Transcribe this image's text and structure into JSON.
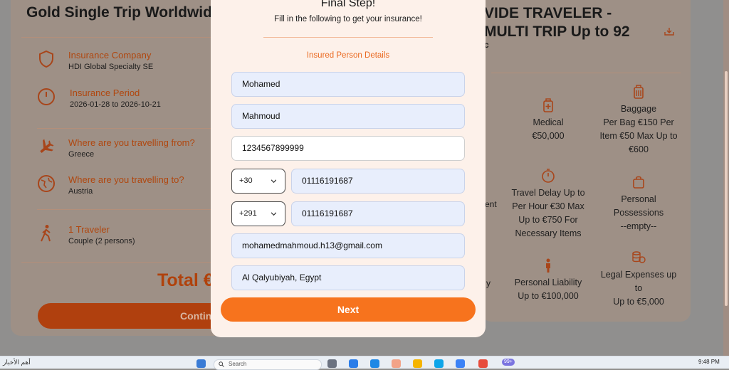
{
  "background": {
    "left_plan_title": "Gold Single Trip Worldwide",
    "right_plan_title_line1": "VIDE TRAVELER -",
    "right_plan_title_line2": "MULTI TRIP Up to 92",
    "right_plan_title_line3": "c",
    "insurance_company_label": "Insurance Company",
    "insurance_company_value": "HDI Global Specialty SE",
    "insurance_period_label": "Insurance Period",
    "insurance_period_value": "2026-01-28 to 2026-10-21",
    "from_label": "Where are you travelling from?",
    "from_value": "Greece",
    "to_label": "Where are you travelling to?",
    "to_value": "Austria",
    "traveler_label": "1 Traveler",
    "traveler_value": "Couple (2 persons)",
    "total_label": "Total €",
    "continue_label": "Contin",
    "side_text_1": "ent",
    "side_text_2": "y",
    "benefits": [
      {
        "label": "Medical\n€50,000"
      },
      {
        "label": "Baggage\nPer Bag €150 Per\nItem €50 Max Up to\n€600"
      },
      {
        "label": "Travel Delay Up to\nPer Hour €30 Max\nUp to €750 For\nNecessary Items"
      },
      {
        "label": "Personal\nPossessions\n--empty--"
      },
      {
        "label": "Personal Liability\nUp to €100,000"
      },
      {
        "label": "Legal Expenses up\nto\nUp to €5,000"
      }
    ]
  },
  "modal": {
    "title": "Final Step!",
    "subtitle": "Fill in the following to get your insurance!",
    "section_title": "Insured Person Details",
    "first_name": "Mohamed",
    "last_name": "Mahmoud",
    "id_number": "1234567899999",
    "phone1_code": "+30",
    "phone1_number": "01116191687",
    "phone2_code": "+291",
    "phone2_number": "01116191687",
    "email": "mohamedmahmoud.h13@gmail.com",
    "address": "Al Qalyubiyah, Egypt",
    "next_label": "Next"
  },
  "taskbar": {
    "news_label": "أهم الأخبار",
    "search_placeholder": "Search",
    "badge": "99+",
    "time": "9:48 PM"
  },
  "colors": {
    "accent": "#f7731d",
    "field_bg": "#e8eefc",
    "modal_bg": "#fdf1ea",
    "section_title": "#ea6a22"
  }
}
